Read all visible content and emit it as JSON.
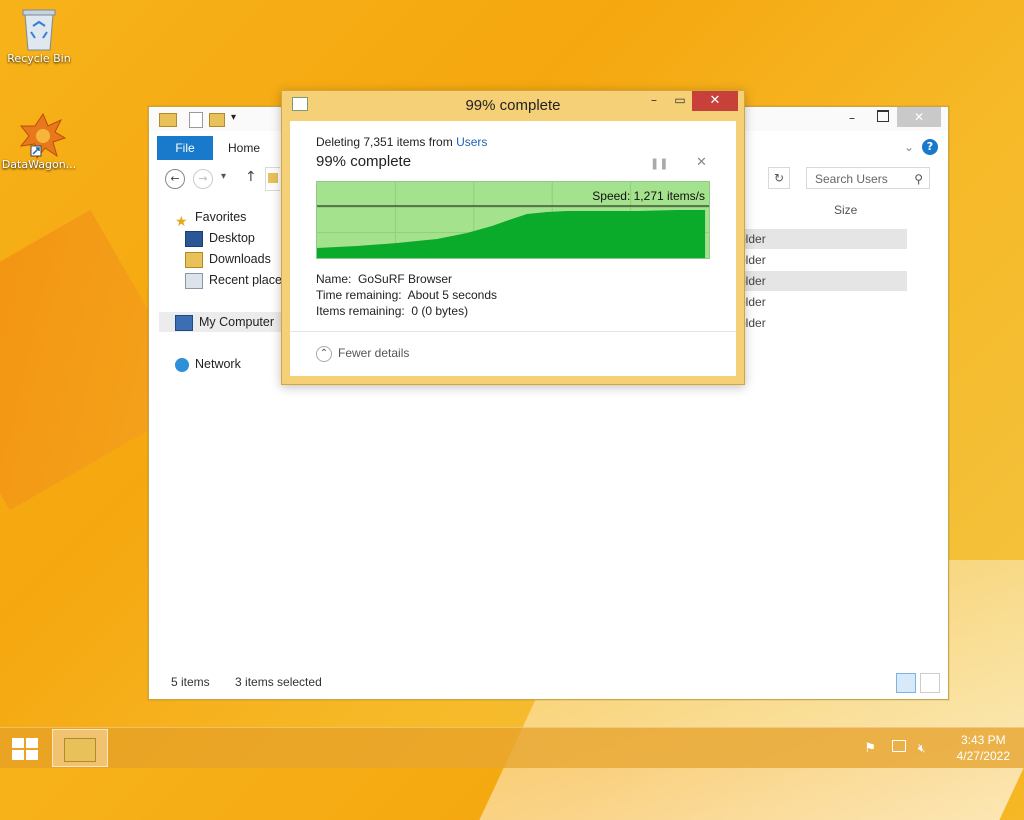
{
  "desktop": {
    "icons": [
      {
        "label": "Recycle Bin",
        "icon": "recycle-bin-icon"
      },
      {
        "label": "DataWagon...",
        "icon": "datawagon-icon"
      }
    ]
  },
  "explorer": {
    "tabs": {
      "file": "File",
      "home": "Home"
    },
    "search_placeholder": "Search Users",
    "nav": {
      "favorites": "Favorites",
      "desktop": "Desktop",
      "downloads": "Downloads",
      "recent": "Recent places",
      "computer": "My Computer",
      "network": "Network"
    },
    "size_header": "Size",
    "rows": [
      "older",
      "older",
      "older",
      "older",
      "older"
    ],
    "status": {
      "items": "5 items",
      "selected": "3 items selected"
    }
  },
  "dialog": {
    "title": "99% complete",
    "deleting_prefix": "Deleting 7,351 items from ",
    "deleting_target": "Users",
    "percent_text": "99% complete",
    "progress_fraction": 0.99,
    "speed": "Speed: 1,271 items/s",
    "name_label": "Name:",
    "name_value": "GoSuRF Browser",
    "time_label": "Time remaining:",
    "time_value": "About 5 seconds",
    "items_label": "Items remaining:",
    "items_value": "0 (0 bytes)",
    "fewer_details": "Fewer details",
    "colors": {
      "graph_fill": "#0aaa2a",
      "graph_bg": "#a4e28d",
      "close": "#c7403a"
    }
  },
  "taskbar": {
    "time": "3:43 PM",
    "date": "4/27/2022"
  }
}
